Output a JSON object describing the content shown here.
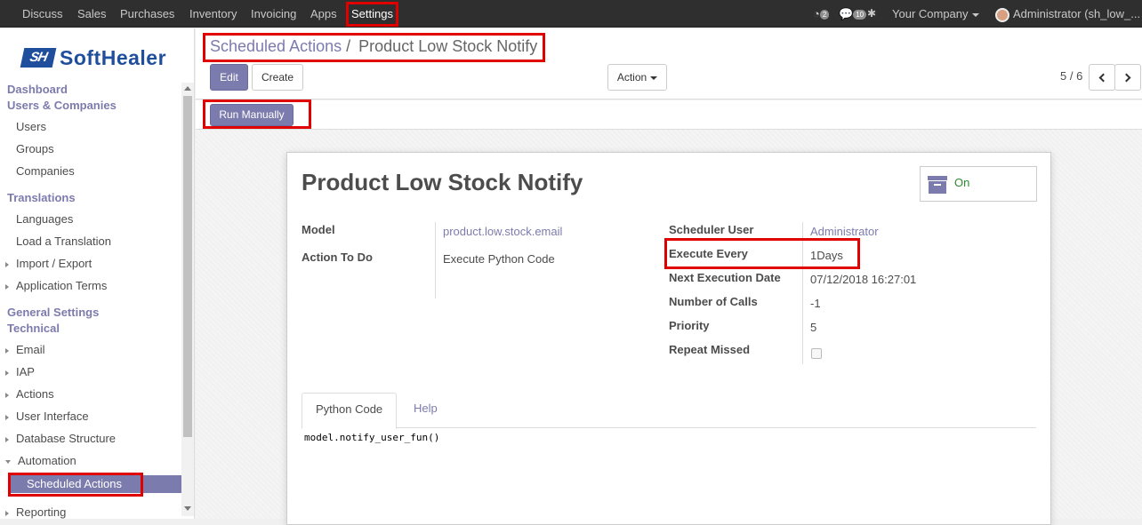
{
  "navbar": {
    "menus": [
      "Discuss",
      "Sales",
      "Purchases",
      "Inventory",
      "Invoicing",
      "Apps",
      "Settings"
    ],
    "activity_count": "2",
    "messages_count": "10",
    "company": "Your Company",
    "user": "Administrator (sh_low_..."
  },
  "sidebar": {
    "logo_mark": "SH",
    "logo_text": "SoftHealer",
    "sections": {
      "dashboard": "Dashboard",
      "users_companies": "Users & Companies",
      "translations": "Translations",
      "general_settings": "General Settings",
      "technical": "Technical"
    },
    "items": {
      "users": "Users",
      "groups": "Groups",
      "companies": "Companies",
      "languages": "Languages",
      "load_translation": "Load a Translation",
      "import_export": "Import / Export",
      "application_terms": "Application Terms",
      "email": "Email",
      "iap": "IAP",
      "actions": "Actions",
      "user_interface": "User Interface",
      "database_structure": "Database Structure",
      "automation": "Automation",
      "scheduled_actions": "Scheduled Actions",
      "reporting": "Reporting"
    }
  },
  "control_panel": {
    "breadcrumb_parent": "Scheduled Actions",
    "breadcrumb_sep": "/",
    "breadcrumb_current": "Product Low Stock Notify",
    "edit_label": "Edit",
    "create_label": "Create",
    "action_label": "Action",
    "pager": "5 / 6"
  },
  "statusbar": {
    "run_manually_label": "Run Manually"
  },
  "form": {
    "title": "Product Low Stock Notify",
    "active_label": "On",
    "left_fields": {
      "model_label": "Model",
      "model_value": "product.low.stock.email",
      "action_label": "Action To Do",
      "action_value": "Execute Python Code"
    },
    "right_fields": {
      "user_label": "Scheduler User",
      "user_value": "Administrator",
      "every_label": "Execute Every",
      "every_value": "1Days",
      "next_label": "Next Execution Date",
      "next_value": "07/12/2018 16:27:01",
      "calls_label": "Number of Calls",
      "calls_value": "-1",
      "priority_label": "Priority",
      "priority_value": "5",
      "repeat_label": "Repeat Missed",
      "repeat_value": false
    },
    "tabs": [
      "Python Code",
      "Help"
    ],
    "code": "model.notify_user_fun()"
  },
  "colors": {
    "accent": "#7c7bad",
    "highlight": "#e00000",
    "navbar": "#2f2f2f"
  }
}
